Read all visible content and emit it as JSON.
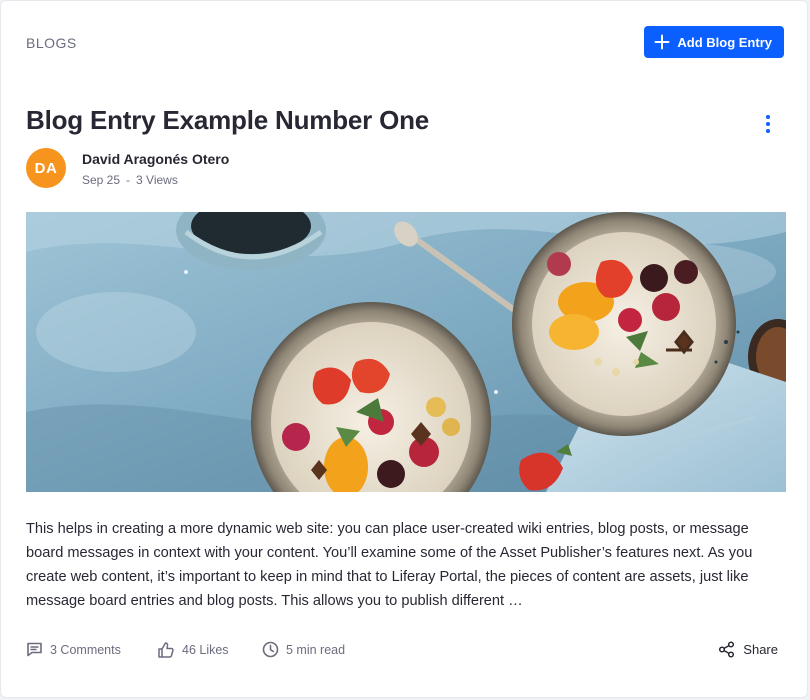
{
  "header": {
    "portlet_title": "BLOGS",
    "add_button_label": "Add Blog Entry",
    "accent_color": "#0b5fff"
  },
  "entry": {
    "title": "Blog Entry Example Number One",
    "author": {
      "initials": "DA",
      "name": "David Aragonés Otero",
      "avatar_color": "#f7941d"
    },
    "date": "Sep 25",
    "meta_separator": "-",
    "views": "3 Views",
    "image_description_icon": "food-bowls-photo",
    "body": "This helps in creating a more dynamic web site: you can place user-created wiki entries, blog posts, or message board messages in context with your content. You’ll examine some of the Asset Publisher’s features next. As you create web content, it’s important to keep in mind that to Liferay Portal, the pieces of content are assets, just like message board entries and blog posts. This allows you to publish different …"
  },
  "footer": {
    "comments": "3 Comments",
    "likes": "46 Likes",
    "read_time": "5 min read",
    "share": "Share"
  },
  "icons": {
    "add": "plus-icon",
    "options": "kebab-menu-icon",
    "comments": "comment-icon",
    "likes": "thumbs-up-icon",
    "read_time": "clock-icon",
    "share": "share-icon"
  }
}
